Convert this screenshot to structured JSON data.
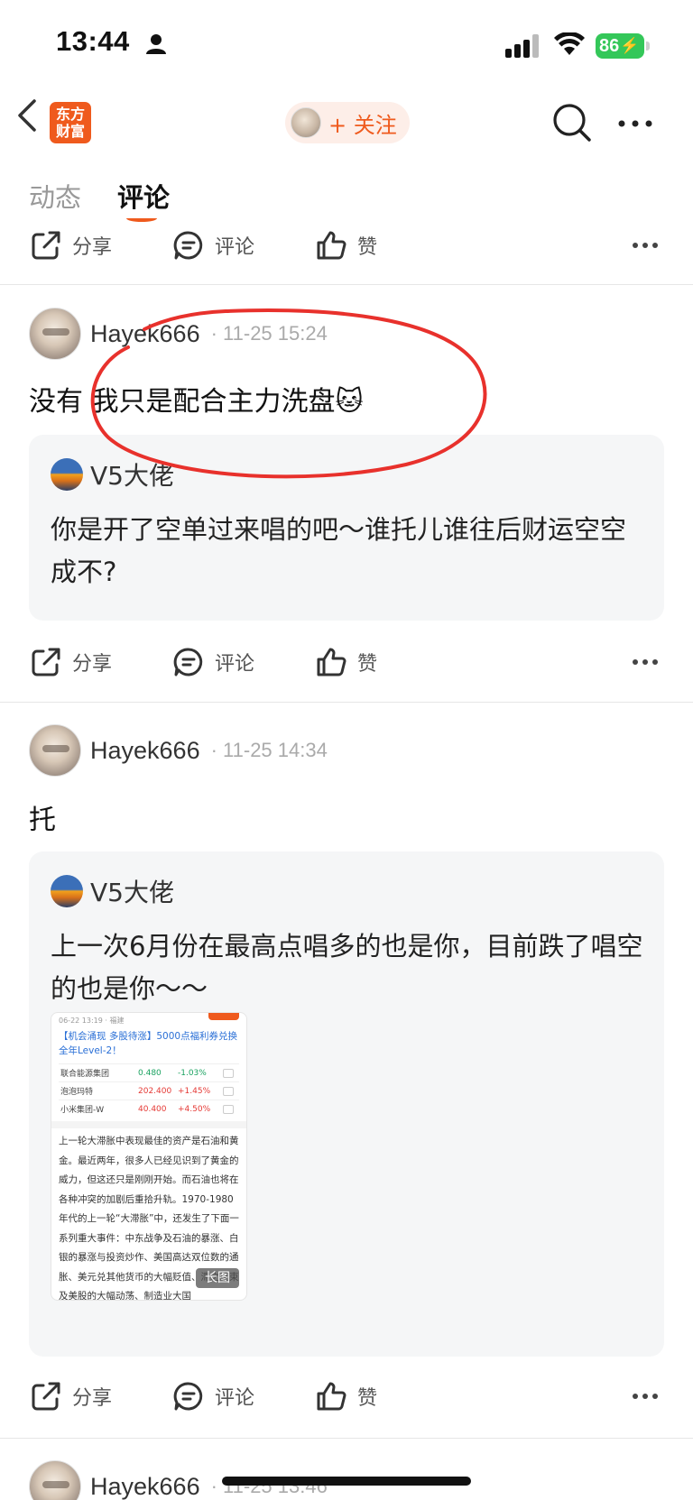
{
  "status_bar": {
    "time": "13:44",
    "battery": "86"
  },
  "nav": {
    "logo_line1": "东方",
    "logo_line2": "财富",
    "follow_label": "+ 关注"
  },
  "tabs": {
    "dynamic": "动态",
    "comments": "评论"
  },
  "actions": {
    "share": "分享",
    "comment": "评论",
    "like": "赞"
  },
  "posts": [
    {
      "username": "Hayek666",
      "time": "· 11-25 15:24",
      "text": "没有 我只是配合主力洗盘",
      "emoji": "🐱",
      "quote": {
        "name": "V5大佬",
        "text": "你是开了空单过来唱的吧～谁托儿谁往后财运空空成不?"
      }
    },
    {
      "username": "Hayek666",
      "time": "· 11-25 14:34",
      "text": "托",
      "quote": {
        "name": "V5大佬",
        "text": "上一次6月份在最高点唱多的也是你，目前跌了唱空的也是你～～",
        "image": {
          "top_meta": "06-22 13:19 · 福建",
          "title": "【机会涌现 多股待涨】5000点福利券兑换全年Level-2！",
          "rows": [
            {
              "name": "联合能源集团",
              "price": "0.480",
              "change": "-1.03%",
              "price_color": "#1aa260",
              "change_color": "#1aa260"
            },
            {
              "name": "泡泡玛特",
              "price": "202.400",
              "change": "+1.45%",
              "price_color": "#e53935",
              "change_color": "#e53935"
            },
            {
              "name": "小米集团-W",
              "price": "40.400",
              "change": "+4.50%",
              "price_color": "#e53935",
              "change_color": "#e53935"
            }
          ],
          "body": "上一轮大滞胀中表现最佳的资产是石油和黄金。最近两年，很多人已经见识到了黄金的威力，但这还只是刚刚开始。而石油也将在各种冲突的加剧后重拾升轨。1970-1980年代的上一轮“大滞胀”中，还发生了下面一系列重大事件：中东战争及石油的暴涨、白银的暴涨与投资炒作、美国高达双位数的通胀、美元兑其他货币的大幅贬值、滞之结束及美股的大幅动荡、制造业大国",
          "long_image_tag": "长图"
        }
      }
    },
    {
      "username": "Hayek666",
      "time": "· 11-25 13:46"
    }
  ],
  "colors": {
    "accent": "#ef5a1d",
    "annotation": "#e8312c"
  }
}
